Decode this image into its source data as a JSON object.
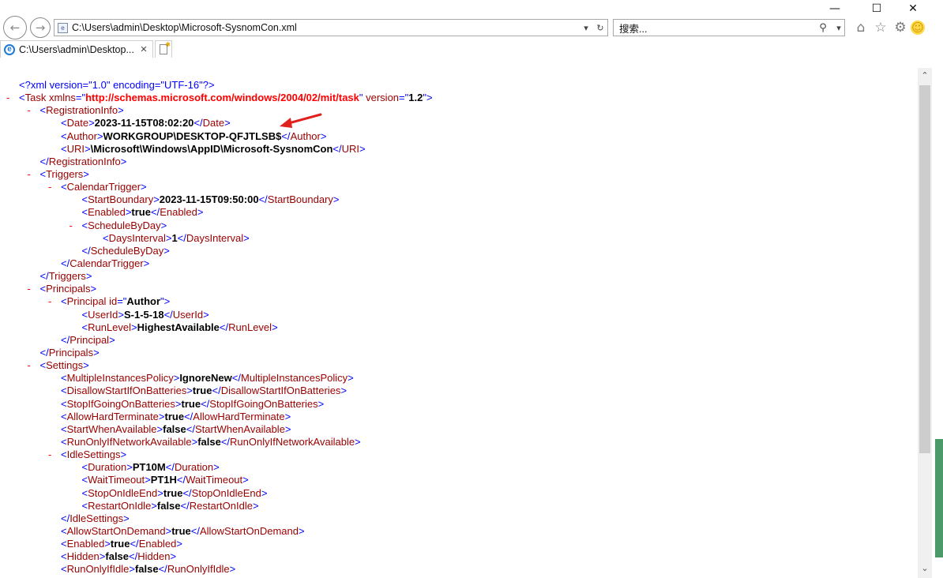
{
  "window": {
    "minimize_icon": "—",
    "maximize_icon": "☐",
    "close_icon": "✕"
  },
  "nav": {
    "back_icon": "←",
    "forward_icon": "→"
  },
  "address": {
    "url": "C:\\Users\\admin\\Desktop\\Microsoft-SysnomCon.xml",
    "dropdown_icon": "▾",
    "refresh_icon": "↻"
  },
  "search": {
    "placeholder": "搜索...",
    "icon": "⚲",
    "dropdown_icon": "▾"
  },
  "toolbar": {
    "home_icon": "⌂",
    "favorites_icon": "☆",
    "settings_icon": "⚙",
    "smiley_icon": "☺"
  },
  "tab": {
    "title": "C:\\Users\\admin\\Desktop...",
    "close_icon": "✕"
  },
  "xml_lines": [
    {
      "indent": 0,
      "minus": false,
      "parts": [
        {
          "c": "pi",
          "t": "<?xml version=\"1.0\" encoding=\"UTF-16\"?>"
        }
      ]
    },
    {
      "indent": 0,
      "minus": true,
      "parts": [
        {
          "c": "b",
          "t": "<"
        },
        {
          "c": "tag",
          "t": "Task"
        },
        {
          "c": "attrn",
          "t": " xmlns"
        },
        {
          "c": "b",
          "t": "=\""
        },
        {
          "c": "xmlns",
          "t": "http://schemas.microsoft.com/windows/2004/02/mit/task"
        },
        {
          "c": "b",
          "t": "\""
        },
        {
          "c": "attrn",
          "t": " version"
        },
        {
          "c": "b",
          "t": "=\""
        },
        {
          "c": "attrv",
          "t": "1.2"
        },
        {
          "c": "b",
          "t": "\">"
        }
      ]
    },
    {
      "indent": 1,
      "minus": true,
      "parts": [
        {
          "c": "b",
          "t": "<"
        },
        {
          "c": "tag",
          "t": "RegistrationInfo"
        },
        {
          "c": "b",
          "t": ">"
        }
      ]
    },
    {
      "indent": 2,
      "minus": false,
      "parts": [
        {
          "c": "b",
          "t": "<"
        },
        {
          "c": "tag",
          "t": "Date"
        },
        {
          "c": "b",
          "t": ">"
        },
        {
          "c": "txt",
          "t": "2023-11-15T08:02:20"
        },
        {
          "c": "b",
          "t": "</"
        },
        {
          "c": "tag",
          "t": "Date"
        },
        {
          "c": "b",
          "t": ">"
        }
      ]
    },
    {
      "indent": 2,
      "minus": false,
      "parts": [
        {
          "c": "b",
          "t": "<"
        },
        {
          "c": "tag",
          "t": "Author"
        },
        {
          "c": "b",
          "t": ">"
        },
        {
          "c": "txt",
          "t": "WORKGROUP\\DESKTOP-QFJTLSB$"
        },
        {
          "c": "b",
          "t": "</"
        },
        {
          "c": "tag",
          "t": "Author"
        },
        {
          "c": "b",
          "t": ">"
        }
      ]
    },
    {
      "indent": 2,
      "minus": false,
      "parts": [
        {
          "c": "b",
          "t": "<"
        },
        {
          "c": "tag",
          "t": "URI"
        },
        {
          "c": "b",
          "t": ">"
        },
        {
          "c": "txt",
          "t": "\\Microsoft\\Windows\\AppID\\Microsoft-SysnomCon"
        },
        {
          "c": "b",
          "t": "</"
        },
        {
          "c": "tag",
          "t": "URI"
        },
        {
          "c": "b",
          "t": ">"
        }
      ]
    },
    {
      "indent": 1,
      "minus": false,
      "parts": [
        {
          "c": "b",
          "t": "</"
        },
        {
          "c": "tag",
          "t": "RegistrationInfo"
        },
        {
          "c": "b",
          "t": ">"
        }
      ]
    },
    {
      "indent": 1,
      "minus": true,
      "parts": [
        {
          "c": "b",
          "t": "<"
        },
        {
          "c": "tag",
          "t": "Triggers"
        },
        {
          "c": "b",
          "t": ">"
        }
      ]
    },
    {
      "indent": 2,
      "minus": true,
      "parts": [
        {
          "c": "b",
          "t": "<"
        },
        {
          "c": "tag",
          "t": "CalendarTrigger"
        },
        {
          "c": "b",
          "t": ">"
        }
      ]
    },
    {
      "indent": 3,
      "minus": false,
      "parts": [
        {
          "c": "b",
          "t": "<"
        },
        {
          "c": "tag",
          "t": "StartBoundary"
        },
        {
          "c": "b",
          "t": ">"
        },
        {
          "c": "txt",
          "t": "2023-11-15T09:50:00"
        },
        {
          "c": "b",
          "t": "</"
        },
        {
          "c": "tag",
          "t": "StartBoundary"
        },
        {
          "c": "b",
          "t": ">"
        }
      ]
    },
    {
      "indent": 3,
      "minus": false,
      "parts": [
        {
          "c": "b",
          "t": "<"
        },
        {
          "c": "tag",
          "t": "Enabled"
        },
        {
          "c": "b",
          "t": ">"
        },
        {
          "c": "txt",
          "t": "true"
        },
        {
          "c": "b",
          "t": "</"
        },
        {
          "c": "tag",
          "t": "Enabled"
        },
        {
          "c": "b",
          "t": ">"
        }
      ]
    },
    {
      "indent": 3,
      "minus": true,
      "parts": [
        {
          "c": "b",
          "t": "<"
        },
        {
          "c": "tag",
          "t": "ScheduleByDay"
        },
        {
          "c": "b",
          "t": ">"
        }
      ]
    },
    {
      "indent": 4,
      "minus": false,
      "parts": [
        {
          "c": "b",
          "t": "<"
        },
        {
          "c": "tag",
          "t": "DaysInterval"
        },
        {
          "c": "b",
          "t": ">"
        },
        {
          "c": "txt",
          "t": "1"
        },
        {
          "c": "b",
          "t": "</"
        },
        {
          "c": "tag",
          "t": "DaysInterval"
        },
        {
          "c": "b",
          "t": ">"
        }
      ]
    },
    {
      "indent": 3,
      "minus": false,
      "parts": [
        {
          "c": "b",
          "t": "</"
        },
        {
          "c": "tag",
          "t": "ScheduleByDay"
        },
        {
          "c": "b",
          "t": ">"
        }
      ]
    },
    {
      "indent": 2,
      "minus": false,
      "parts": [
        {
          "c": "b",
          "t": "</"
        },
        {
          "c": "tag",
          "t": "CalendarTrigger"
        },
        {
          "c": "b",
          "t": ">"
        }
      ]
    },
    {
      "indent": 1,
      "minus": false,
      "parts": [
        {
          "c": "b",
          "t": "</"
        },
        {
          "c": "tag",
          "t": "Triggers"
        },
        {
          "c": "b",
          "t": ">"
        }
      ]
    },
    {
      "indent": 1,
      "minus": true,
      "parts": [
        {
          "c": "b",
          "t": "<"
        },
        {
          "c": "tag",
          "t": "Principals"
        },
        {
          "c": "b",
          "t": ">"
        }
      ]
    },
    {
      "indent": 2,
      "minus": true,
      "parts": [
        {
          "c": "b",
          "t": "<"
        },
        {
          "c": "tag",
          "t": "Principal"
        },
        {
          "c": "attrn",
          "t": " id"
        },
        {
          "c": "b",
          "t": "=\""
        },
        {
          "c": "attrv",
          "t": "Author"
        },
        {
          "c": "b",
          "t": "\">"
        }
      ]
    },
    {
      "indent": 3,
      "minus": false,
      "parts": [
        {
          "c": "b",
          "t": "<"
        },
        {
          "c": "tag",
          "t": "UserId"
        },
        {
          "c": "b",
          "t": ">"
        },
        {
          "c": "txt",
          "t": "S-1-5-18"
        },
        {
          "c": "b",
          "t": "</"
        },
        {
          "c": "tag",
          "t": "UserId"
        },
        {
          "c": "b",
          "t": ">"
        }
      ]
    },
    {
      "indent": 3,
      "minus": false,
      "parts": [
        {
          "c": "b",
          "t": "<"
        },
        {
          "c": "tag",
          "t": "RunLevel"
        },
        {
          "c": "b",
          "t": ">"
        },
        {
          "c": "txt",
          "t": "HighestAvailable"
        },
        {
          "c": "b",
          "t": "</"
        },
        {
          "c": "tag",
          "t": "RunLevel"
        },
        {
          "c": "b",
          "t": ">"
        }
      ]
    },
    {
      "indent": 2,
      "minus": false,
      "parts": [
        {
          "c": "b",
          "t": "</"
        },
        {
          "c": "tag",
          "t": "Principal"
        },
        {
          "c": "b",
          "t": ">"
        }
      ]
    },
    {
      "indent": 1,
      "minus": false,
      "parts": [
        {
          "c": "b",
          "t": "</"
        },
        {
          "c": "tag",
          "t": "Principals"
        },
        {
          "c": "b",
          "t": ">"
        }
      ]
    },
    {
      "indent": 1,
      "minus": true,
      "parts": [
        {
          "c": "b",
          "t": "<"
        },
        {
          "c": "tag",
          "t": "Settings"
        },
        {
          "c": "b",
          "t": ">"
        }
      ]
    },
    {
      "indent": 2,
      "minus": false,
      "parts": [
        {
          "c": "b",
          "t": "<"
        },
        {
          "c": "tag",
          "t": "MultipleInstancesPolicy"
        },
        {
          "c": "b",
          "t": ">"
        },
        {
          "c": "txt",
          "t": "IgnoreNew"
        },
        {
          "c": "b",
          "t": "</"
        },
        {
          "c": "tag",
          "t": "MultipleInstancesPolicy"
        },
        {
          "c": "b",
          "t": ">"
        }
      ]
    },
    {
      "indent": 2,
      "minus": false,
      "parts": [
        {
          "c": "b",
          "t": "<"
        },
        {
          "c": "tag",
          "t": "DisallowStartIfOnBatteries"
        },
        {
          "c": "b",
          "t": ">"
        },
        {
          "c": "txt",
          "t": "true"
        },
        {
          "c": "b",
          "t": "</"
        },
        {
          "c": "tag",
          "t": "DisallowStartIfOnBatteries"
        },
        {
          "c": "b",
          "t": ">"
        }
      ]
    },
    {
      "indent": 2,
      "minus": false,
      "parts": [
        {
          "c": "b",
          "t": "<"
        },
        {
          "c": "tag",
          "t": "StopIfGoingOnBatteries"
        },
        {
          "c": "b",
          "t": ">"
        },
        {
          "c": "txt",
          "t": "true"
        },
        {
          "c": "b",
          "t": "</"
        },
        {
          "c": "tag",
          "t": "StopIfGoingOnBatteries"
        },
        {
          "c": "b",
          "t": ">"
        }
      ]
    },
    {
      "indent": 2,
      "minus": false,
      "parts": [
        {
          "c": "b",
          "t": "<"
        },
        {
          "c": "tag",
          "t": "AllowHardTerminate"
        },
        {
          "c": "b",
          "t": ">"
        },
        {
          "c": "txt",
          "t": "true"
        },
        {
          "c": "b",
          "t": "</"
        },
        {
          "c": "tag",
          "t": "AllowHardTerminate"
        },
        {
          "c": "b",
          "t": ">"
        }
      ]
    },
    {
      "indent": 2,
      "minus": false,
      "parts": [
        {
          "c": "b",
          "t": "<"
        },
        {
          "c": "tag",
          "t": "StartWhenAvailable"
        },
        {
          "c": "b",
          "t": ">"
        },
        {
          "c": "txt",
          "t": "false"
        },
        {
          "c": "b",
          "t": "</"
        },
        {
          "c": "tag",
          "t": "StartWhenAvailable"
        },
        {
          "c": "b",
          "t": ">"
        }
      ]
    },
    {
      "indent": 2,
      "minus": false,
      "parts": [
        {
          "c": "b",
          "t": "<"
        },
        {
          "c": "tag",
          "t": "RunOnlyIfNetworkAvailable"
        },
        {
          "c": "b",
          "t": ">"
        },
        {
          "c": "txt",
          "t": "false"
        },
        {
          "c": "b",
          "t": "</"
        },
        {
          "c": "tag",
          "t": "RunOnlyIfNetworkAvailable"
        },
        {
          "c": "b",
          "t": ">"
        }
      ]
    },
    {
      "indent": 2,
      "minus": true,
      "parts": [
        {
          "c": "b",
          "t": "<"
        },
        {
          "c": "tag",
          "t": "IdleSettings"
        },
        {
          "c": "b",
          "t": ">"
        }
      ]
    },
    {
      "indent": 3,
      "minus": false,
      "parts": [
        {
          "c": "b",
          "t": "<"
        },
        {
          "c": "tag",
          "t": "Duration"
        },
        {
          "c": "b",
          "t": ">"
        },
        {
          "c": "txt",
          "t": "PT10M"
        },
        {
          "c": "b",
          "t": "</"
        },
        {
          "c": "tag",
          "t": "Duration"
        },
        {
          "c": "b",
          "t": ">"
        }
      ]
    },
    {
      "indent": 3,
      "minus": false,
      "parts": [
        {
          "c": "b",
          "t": "<"
        },
        {
          "c": "tag",
          "t": "WaitTimeout"
        },
        {
          "c": "b",
          "t": ">"
        },
        {
          "c": "txt",
          "t": "PT1H"
        },
        {
          "c": "b",
          "t": "</"
        },
        {
          "c": "tag",
          "t": "WaitTimeout"
        },
        {
          "c": "b",
          "t": ">"
        }
      ]
    },
    {
      "indent": 3,
      "minus": false,
      "parts": [
        {
          "c": "b",
          "t": "<"
        },
        {
          "c": "tag",
          "t": "StopOnIdleEnd"
        },
        {
          "c": "b",
          "t": ">"
        },
        {
          "c": "txt",
          "t": "true"
        },
        {
          "c": "b",
          "t": "</"
        },
        {
          "c": "tag",
          "t": "StopOnIdleEnd"
        },
        {
          "c": "b",
          "t": ">"
        }
      ]
    },
    {
      "indent": 3,
      "minus": false,
      "parts": [
        {
          "c": "b",
          "t": "<"
        },
        {
          "c": "tag",
          "t": "RestartOnIdle"
        },
        {
          "c": "b",
          "t": ">"
        },
        {
          "c": "txt",
          "t": "false"
        },
        {
          "c": "b",
          "t": "</"
        },
        {
          "c": "tag",
          "t": "RestartOnIdle"
        },
        {
          "c": "b",
          "t": ">"
        }
      ]
    },
    {
      "indent": 2,
      "minus": false,
      "parts": [
        {
          "c": "b",
          "t": "</"
        },
        {
          "c": "tag",
          "t": "IdleSettings"
        },
        {
          "c": "b",
          "t": ">"
        }
      ]
    },
    {
      "indent": 2,
      "minus": false,
      "parts": [
        {
          "c": "b",
          "t": "<"
        },
        {
          "c": "tag",
          "t": "AllowStartOnDemand"
        },
        {
          "c": "b",
          "t": ">"
        },
        {
          "c": "txt",
          "t": "true"
        },
        {
          "c": "b",
          "t": "</"
        },
        {
          "c": "tag",
          "t": "AllowStartOnDemand"
        },
        {
          "c": "b",
          "t": ">"
        }
      ]
    },
    {
      "indent": 2,
      "minus": false,
      "parts": [
        {
          "c": "b",
          "t": "<"
        },
        {
          "c": "tag",
          "t": "Enabled"
        },
        {
          "c": "b",
          "t": ">"
        },
        {
          "c": "txt",
          "t": "true"
        },
        {
          "c": "b",
          "t": "</"
        },
        {
          "c": "tag",
          "t": "Enabled"
        },
        {
          "c": "b",
          "t": ">"
        }
      ]
    },
    {
      "indent": 2,
      "minus": false,
      "parts": [
        {
          "c": "b",
          "t": "<"
        },
        {
          "c": "tag",
          "t": "Hidden"
        },
        {
          "c": "b",
          "t": ">"
        },
        {
          "c": "txt",
          "t": "false"
        },
        {
          "c": "b",
          "t": "</"
        },
        {
          "c": "tag",
          "t": "Hidden"
        },
        {
          "c": "b",
          "t": ">"
        }
      ]
    },
    {
      "indent": 2,
      "minus": false,
      "parts": [
        {
          "c": "b",
          "t": "<"
        },
        {
          "c": "tag",
          "t": "RunOnlyIfIdle"
        },
        {
          "c": "b",
          "t": ">"
        },
        {
          "c": "txt",
          "t": "false"
        },
        {
          "c": "b",
          "t": "</"
        },
        {
          "c": "tag",
          "t": "RunOnlyIfIdle"
        },
        {
          "c": "b",
          "t": ">"
        }
      ]
    }
  ],
  "scroll": {
    "up_icon": "⌃",
    "down_icon": "⌄"
  },
  "colors": {
    "tag": "#990000",
    "bracket": "#0000ff",
    "minus": "#ff0000",
    "xmlns": "#ff0000",
    "arrow": "#e0201c"
  }
}
